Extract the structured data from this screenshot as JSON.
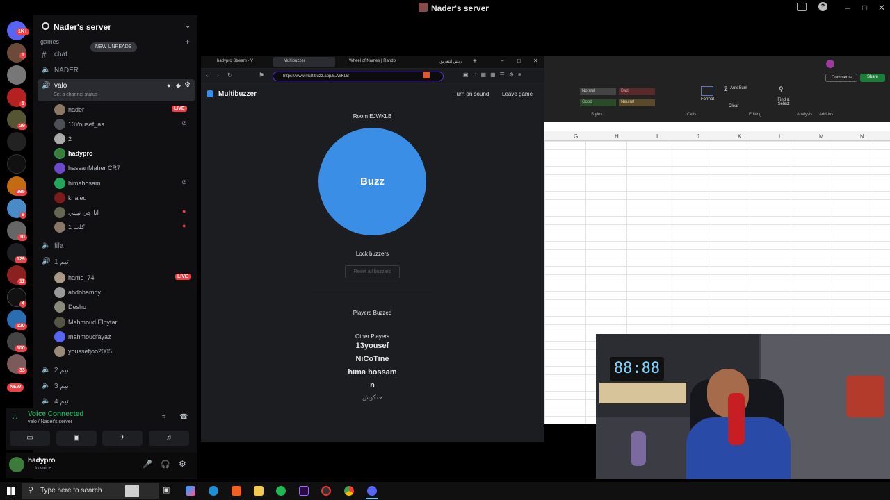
{
  "window": {
    "title": "Nader's server"
  },
  "rail": {
    "badges": [
      "1K+",
      "1",
      "1",
      "29",
      "295",
      "6",
      "10",
      "129",
      "11",
      "4",
      "120",
      "100",
      "33",
      "NEW"
    ]
  },
  "sidebar": {
    "server_name": "Nader's server",
    "games_category": "games",
    "new_unreads": "NEW UNREADS",
    "chat": "chat",
    "nader_channel": "NADER",
    "valo": {
      "name": "valo",
      "status": "Set a channel status",
      "members": [
        "nader",
        "13Yousef_as",
        "2",
        "hadypro",
        "hassanMaher CR7",
        "himahosam",
        "khaled",
        "انا جي نبيني",
        "كلب 1"
      ]
    },
    "fifa": "fifa",
    "channel_1": "1 تيم",
    "channel_1_members": [
      "hamo_74",
      "abdohamdy",
      "Desho",
      "Mahmoud Elbytar",
      "mahmoudfayaz",
      "youssefjoo2005"
    ],
    "channel_2": "2 تيم",
    "channel_3": "3 تيم",
    "channel_4": "4 تيم",
    "live": "LIVE"
  },
  "voice": {
    "status": "Voice Connected",
    "location": "valo / Nader's server"
  },
  "user": {
    "name": "hadypro",
    "status": "In voice"
  },
  "browser": {
    "tabs": [
      "hadypro Stream - V",
      "Multibuzzer",
      "Wheel of Names | Rando",
      "ريش انتعريق"
    ],
    "url": "https://www.multibuzz.app/EJWKLB"
  },
  "multibuzzer": {
    "logo": "Multibuzzer",
    "turn_on_sound": "Turn on sound",
    "leave_game": "Leave game",
    "room": "Room EJWKLB",
    "buzz": "Buzz",
    "lock": "Lock buzzers",
    "reset": "Reset all buzzers",
    "players_buzzed": "Players Buzzed",
    "other_players": "Other Players",
    "players": [
      "13yousef",
      "NiCoTine",
      "hima hossam",
      "n"
    ],
    "last_player": "حنكوش"
  },
  "excel": {
    "comments": "Comments",
    "share": "Share",
    "styles": [
      "Normal",
      "Bad",
      "Good",
      "Neutral"
    ],
    "ribbon_groups": [
      "Styles",
      "Cells",
      "Editing",
      "Analysis",
      "Add-ins"
    ],
    "ribbon_buttons": [
      "Format",
      "AutoSum",
      "Clear",
      "Find & Select"
    ],
    "columns": [
      "G",
      "H",
      "I",
      "J",
      "K",
      "L",
      "M",
      "N"
    ]
  },
  "taskbar": {
    "search_placeholder": "Type here to search"
  }
}
